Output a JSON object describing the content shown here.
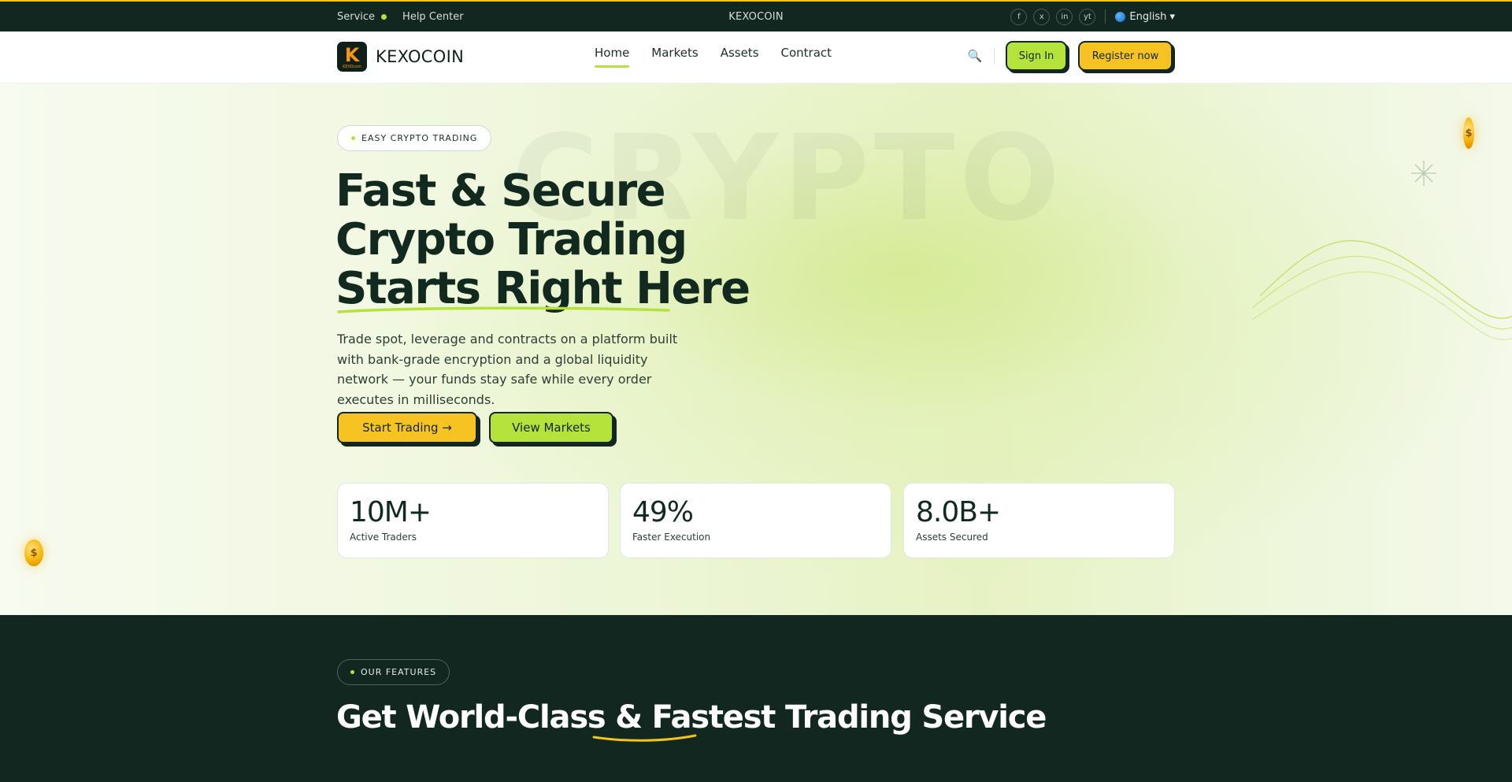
{
  "topbar": {
    "service": "Service",
    "help": "Help Center",
    "center_brand": "KEXOCOIN",
    "socials": [
      "f",
      "x",
      "in",
      "yt"
    ],
    "language": "English ▾",
    "colors": {
      "background": "#11271f",
      "accent_line": "#f2c318"
    }
  },
  "header": {
    "logo_text": "KEXOCOIN",
    "logo_mark": "K",
    "logo_mini": "KEXOcoin",
    "nav": [
      {
        "label": "Home",
        "active": true
      },
      {
        "label": "Markets",
        "active": false
      },
      {
        "label": "Assets",
        "active": false
      },
      {
        "label": "Contract",
        "active": false
      }
    ],
    "search_icon": "🔍",
    "signin_label": "Sign In",
    "register_label": "Register now",
    "colors": {
      "lime": "#b6e33b",
      "yellow": "#f7c323",
      "dark": "#11271f"
    }
  },
  "hero": {
    "watermark": "CRYPTO",
    "badge": "EASY CRYPTO TRADING",
    "title_lines": [
      "Fast & Secure",
      "Crypto Trading",
      "Starts Right Here"
    ],
    "description": "Trade spot, leverage and contracts on a platform built with bank-grade encryption and a global liquidity network — your funds stay safe while every order executes in milliseconds.",
    "cta_primary": "Start Trading →",
    "cta_secondary": "View Markets",
    "coin_symbol": "$",
    "stats": [
      {
        "value": "10M+",
        "label": "Active Traders"
      },
      {
        "value": "49%",
        "label": "Faster Execution"
      },
      {
        "value": "8.0B+",
        "label": "Assets Secured"
      }
    ]
  },
  "features": {
    "badge": "OUR FEATURES",
    "title_before": "Get World-Class & ",
    "title_highlight": "Fastest",
    "title_after": " Trading Service"
  }
}
